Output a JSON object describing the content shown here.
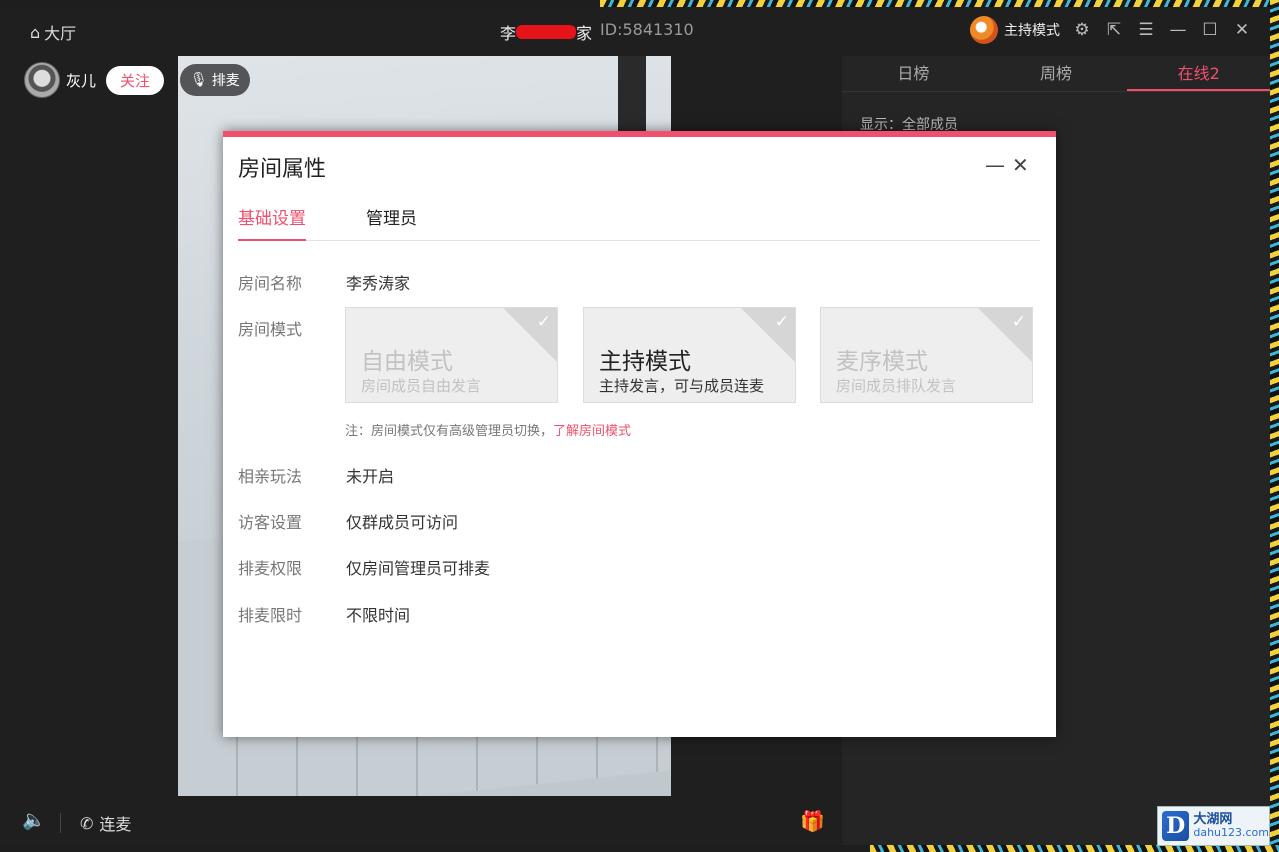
{
  "titlebar": {
    "lobby_label": "大厅",
    "room_name_visible": "李",
    "room_name_tail": "家",
    "room_id": "ID:5841310",
    "mode_label": "主持模式"
  },
  "host": {
    "name": "灰儿",
    "follow_label": "关注"
  },
  "queue_button": "排麦",
  "bottom": {
    "connect_label": "连麦"
  },
  "right_panel": {
    "tabs": [
      {
        "label": "日榜"
      },
      {
        "label": "周榜"
      },
      {
        "label": "在线2"
      }
    ],
    "filter_text": "显示：全部成员"
  },
  "dialog": {
    "title": "房间属性",
    "tabs": [
      {
        "label": "基础设置"
      },
      {
        "label": "管理员"
      }
    ],
    "room_name_label": "房间名称",
    "room_name_value": "李秀涛家",
    "room_mode_label": "房间模式",
    "modes": [
      {
        "name": "自由模式",
        "desc": "房间成员自由发言",
        "selected": false
      },
      {
        "name": "主持模式",
        "desc": "主持发言，可与成员连麦",
        "selected": true
      },
      {
        "name": "麦序模式",
        "desc": "房间成员排队发言",
        "selected": false
      }
    ],
    "note": "注：房间模式仅有高级管理员切换，",
    "note_link": "了解房间模式",
    "matchmaking_label": "相亲玩法",
    "matchmaking_value": "未开启",
    "visitor_label": "访客设置",
    "visitor_value": "仅群成员可访问",
    "queue_perm_label": "排麦权限",
    "queue_perm_value": "仅房间管理员可排麦",
    "queue_limit_label": "排麦限时",
    "queue_limit_value": "不限时间"
  },
  "watermark": {
    "logo_letter": "D",
    "name": "大湖网",
    "url": "dahu123.com"
  },
  "colors": {
    "accent": "#f0506e",
    "window_bg": "#1f1f1f"
  }
}
